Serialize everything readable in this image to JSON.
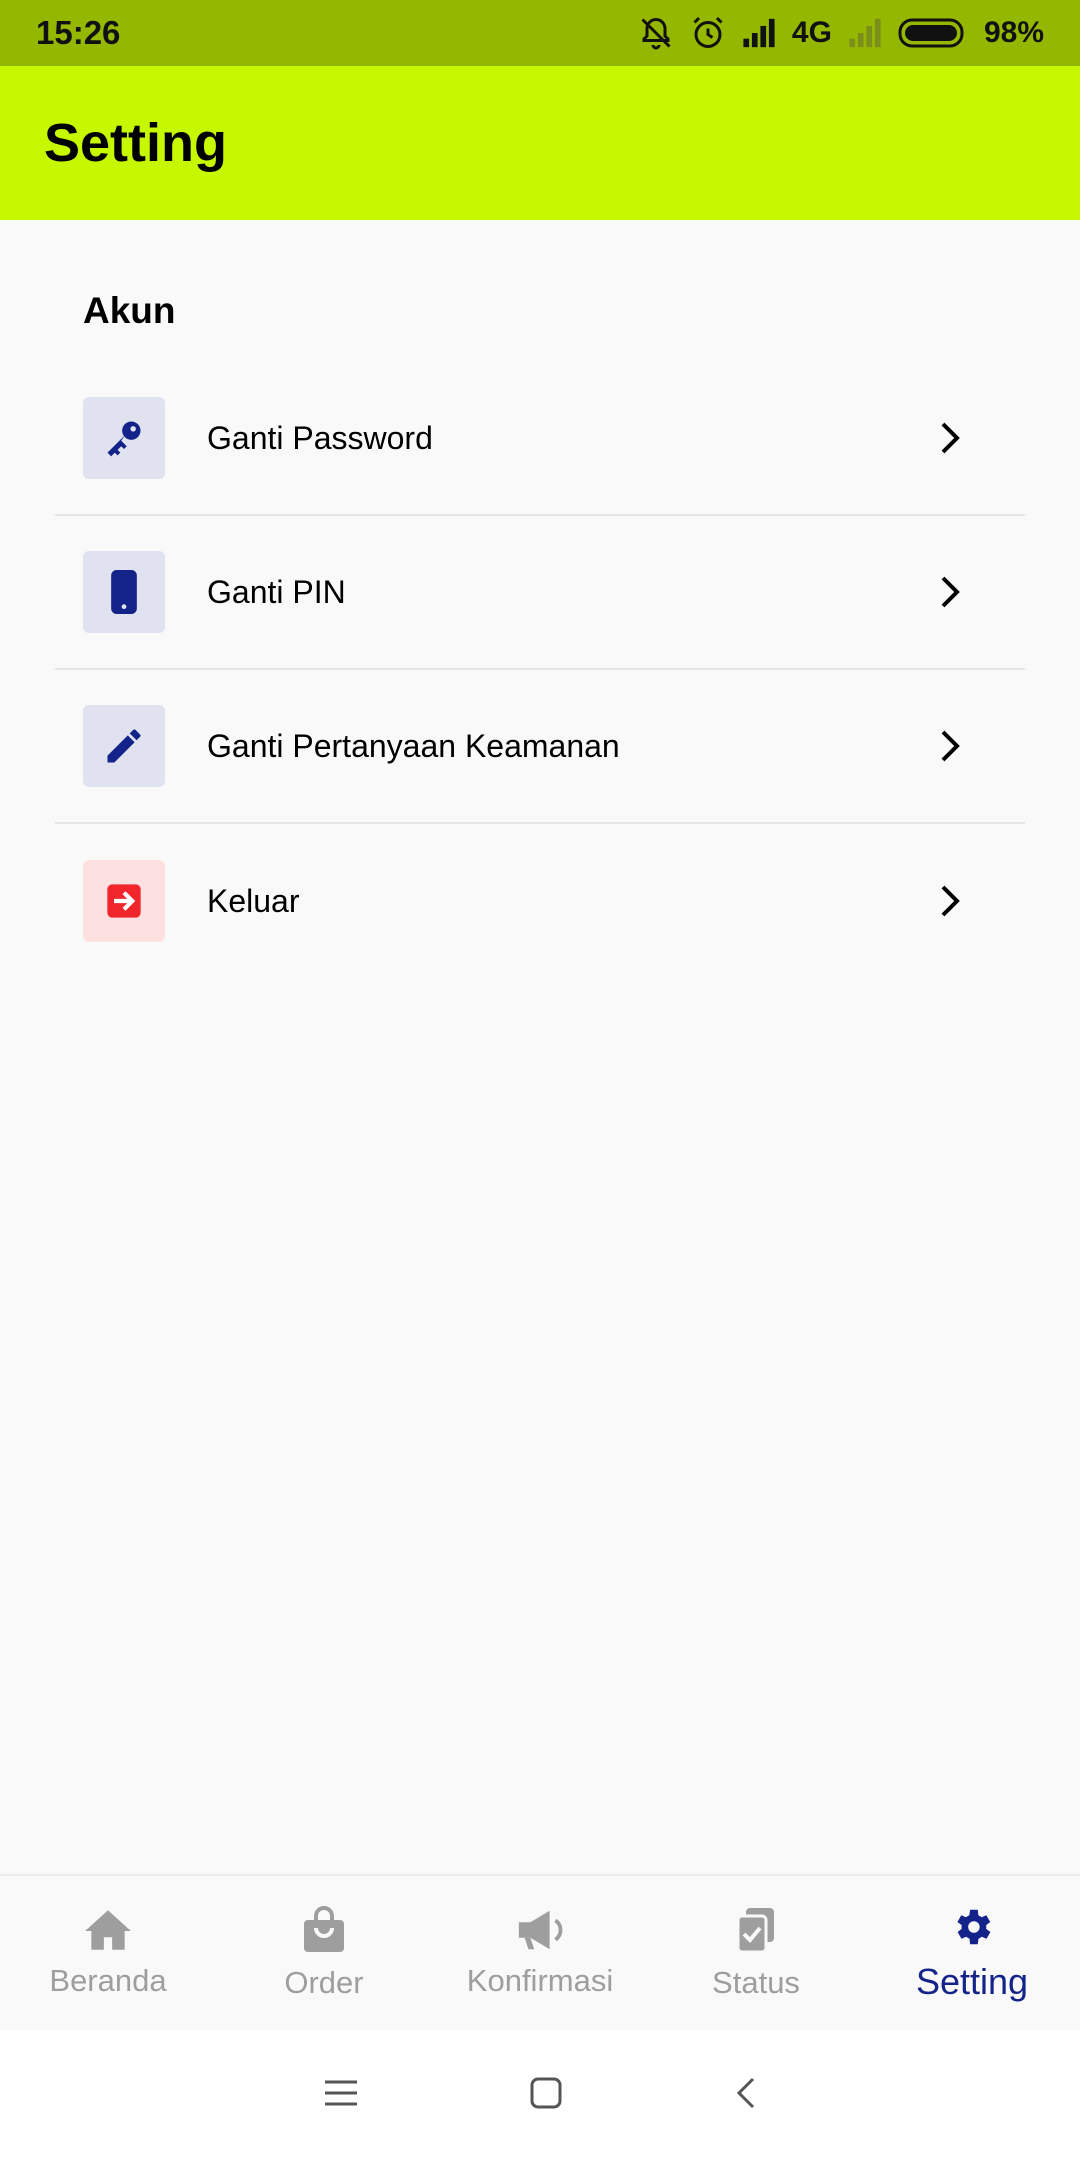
{
  "status_bar": {
    "time": "15:26",
    "network": "4G",
    "battery": "98%"
  },
  "app_bar": {
    "title": "Setting"
  },
  "section": {
    "title": "Akun"
  },
  "menu": [
    {
      "label": "Ganti Password",
      "icon": "key-icon",
      "icon_color": "#14238a"
    },
    {
      "label": "Ganti PIN",
      "icon": "phone-icon",
      "icon_color": "#14238a"
    },
    {
      "label": "Ganti Pertanyaan Keamanan",
      "icon": "pencil-icon",
      "icon_color": "#14238a"
    },
    {
      "label": "Keluar",
      "icon": "logout-icon",
      "icon_color": "#f0262c"
    }
  ],
  "bottom_nav": [
    {
      "label": "Beranda",
      "icon": "home-icon"
    },
    {
      "label": "Order",
      "icon": "shopping-bag-icon"
    },
    {
      "label": "Konfirmasi",
      "icon": "megaphone-icon"
    },
    {
      "label": "Status",
      "icon": "clipboard-check-icon"
    },
    {
      "label": "Setting",
      "icon": "gear-icon",
      "active": true
    }
  ],
  "colors": {
    "status_bar": "#94b800",
    "app_bar": "#c6f800",
    "accent": "#14238a",
    "danger": "#f0262c"
  }
}
